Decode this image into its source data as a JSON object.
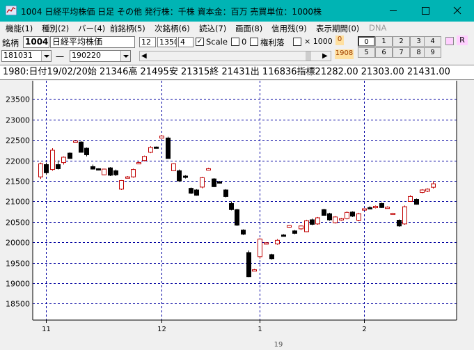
{
  "window": {
    "title": "1004 日経平均株価 日足 その他 発行株：千株 資本金：百万 売買単位：1000株"
  },
  "menu": [
    {
      "label": "機能(1)",
      "enabled": true
    },
    {
      "label": "種別(2)",
      "enabled": true
    },
    {
      "label": "バー(4)",
      "enabled": true
    },
    {
      "label": "前銘柄(5)",
      "enabled": true
    },
    {
      "label": "次銘柄(6)",
      "enabled": true
    },
    {
      "label": "読込(7)",
      "enabled": true
    },
    {
      "label": "画面(8)",
      "enabled": true
    },
    {
      "label": "信用残(9)",
      "enabled": true
    },
    {
      "label": "表示期間(0)",
      "enabled": true
    },
    {
      "label": "DNA",
      "enabled": false
    }
  ],
  "toolbar": {
    "code_label": "銘柄",
    "code_value": "1004",
    "name_value": "日経平均株価",
    "field1": "12",
    "field2": "1350",
    "field3": "4",
    "scale_label": "Scale",
    "scale_checked": true,
    "zero_label": "0",
    "kenri_label": "権利落",
    "x1000_label": "× 1000",
    "top_badge": "0",
    "year_badge": "1908",
    "num_buttons": [
      "0",
      "1",
      "2",
      "3",
      "4",
      "5",
      "6",
      "7",
      "8",
      "9"
    ],
    "r_label": "R",
    "start_date": "181031",
    "dash": "一",
    "end_date": "190220"
  },
  "info_line": "1980:日付19/02/20始 21346高 21495安 21315終 21431出 116836指標21282.00  21303.00  21431.00",
  "colors": {
    "titlebar": "#00b4b4",
    "up_candle": "#c00000",
    "down_candle": "#000000",
    "grid": "#0000a0"
  },
  "chart_data": {
    "type": "candlestick",
    "ylim": [
      18100,
      23950
    ],
    "y_ticks": [
      18500,
      19000,
      19500,
      20000,
      20500,
      21000,
      21500,
      22000,
      22500,
      23000,
      23500
    ],
    "x_tick_labels": [
      {
        "label": "11",
        "index": 1
      },
      {
        "label": "12",
        "index": 21
      },
      {
        "label": "1",
        "index": 38
      },
      {
        "label": "2",
        "index": 56
      }
    ],
    "year_label": "19",
    "candles": [
      {
        "o": 21600,
        "h": 21950,
        "l": 21550,
        "c": 21920
      },
      {
        "o": 21900,
        "h": 21950,
        "l": 21650,
        "c": 21700
      },
      {
        "o": 21780,
        "h": 22300,
        "l": 21750,
        "c": 22250
      },
      {
        "o": 21900,
        "h": 22000,
        "l": 21780,
        "c": 21800
      },
      {
        "o": 21950,
        "h": 22100,
        "l": 21900,
        "c": 22080
      },
      {
        "o": 22180,
        "h": 22200,
        "l": 22050,
        "c": 22050
      },
      {
        "o": 22460,
        "h": 22490,
        "l": 22450,
        "c": 22480
      },
      {
        "o": 22450,
        "h": 22470,
        "l": 22200,
        "c": 22200
      },
      {
        "o": 22300,
        "h": 22320,
        "l": 22100,
        "c": 22140
      },
      {
        "o": 21850,
        "h": 21900,
        "l": 21780,
        "c": 21790
      },
      {
        "o": 21800,
        "h": 21810,
        "l": 21760,
        "c": 21780
      },
      {
        "o": 21650,
        "h": 21800,
        "l": 21640,
        "c": 21790
      },
      {
        "o": 21820,
        "h": 21840,
        "l": 21620,
        "c": 21640
      },
      {
        "o": 21750,
        "h": 21780,
        "l": 21620,
        "c": 21650
      },
      {
        "o": 21300,
        "h": 21520,
        "l": 21280,
        "c": 21510
      },
      {
        "o": 21580,
        "h": 21620,
        "l": 21560,
        "c": 21600
      },
      {
        "o": 21600,
        "h": 21800,
        "l": 21580,
        "c": 21780
      },
      {
        "o": 21930,
        "h": 21970,
        "l": 21920,
        "c": 21950
      },
      {
        "o": 22000,
        "h": 22120,
        "l": 21980,
        "c": 22100
      },
      {
        "o": 22200,
        "h": 22350,
        "l": 22180,
        "c": 22320
      },
      {
        "o": 22330,
        "h": 22340,
        "l": 22300,
        "c": 22300
      },
      {
        "o": 22550,
        "h": 22620,
        "l": 22540,
        "c": 22600
      },
      {
        "o": 22550,
        "h": 22580,
        "l": 22050,
        "c": 22050
      },
      {
        "o": 21750,
        "h": 21930,
        "l": 21740,
        "c": 21920
      },
      {
        "o": 21750,
        "h": 21780,
        "l": 21480,
        "c": 21500
      },
      {
        "o": 21620,
        "h": 21640,
        "l": 21560,
        "c": 21600
      },
      {
        "o": 21320,
        "h": 21340,
        "l": 21180,
        "c": 21200
      },
      {
        "o": 21280,
        "h": 21300,
        "l": 21140,
        "c": 21150
      },
      {
        "o": 21350,
        "h": 21600,
        "l": 21320,
        "c": 21580
      },
      {
        "o": 21780,
        "h": 21820,
        "l": 21760,
        "c": 21800
      },
      {
        "o": 21550,
        "h": 21570,
        "l": 21350,
        "c": 21360
      },
      {
        "o": 21480,
        "h": 21500,
        "l": 21440,
        "c": 21450
      },
      {
        "o": 21280,
        "h": 21300,
        "l": 21100,
        "c": 21120
      },
      {
        "o": 20950,
        "h": 21000,
        "l": 20780,
        "c": 20800
      },
      {
        "o": 20800,
        "h": 20820,
        "l": 20400,
        "c": 20420
      },
      {
        "o": 20300,
        "h": 20320,
        "l": 20180,
        "c": 20200
      },
      {
        "o": 19750,
        "h": 19800,
        "l": 19150,
        "c": 19160
      },
      {
        "o": 19320,
        "h": 19350,
        "l": 19300,
        "c": 19330
      },
      {
        "o": 19650,
        "h": 20100,
        "l": 19600,
        "c": 20080
      },
      {
        "o": 19980,
        "h": 20000,
        "l": 19950,
        "c": 19990
      },
      {
        "o": 19700,
        "h": 19720,
        "l": 19580,
        "c": 19600
      },
      {
        "o": 19960,
        "h": 20080,
        "l": 19940,
        "c": 20050
      },
      {
        "o": 20180,
        "h": 20200,
        "l": 20160,
        "c": 20170
      },
      {
        "o": 20370,
        "h": 20420,
        "l": 20360,
        "c": 20410
      },
      {
        "o": 20280,
        "h": 20300,
        "l": 20200,
        "c": 20220
      },
      {
        "o": 20330,
        "h": 20410,
        "l": 20300,
        "c": 20400
      },
      {
        "o": 20260,
        "h": 20550,
        "l": 20250,
        "c": 20530
      },
      {
        "o": 20550,
        "h": 20580,
        "l": 20420,
        "c": 20440
      },
      {
        "o": 20450,
        "h": 20620,
        "l": 20430,
        "c": 20600
      },
      {
        "o": 20800,
        "h": 20820,
        "l": 20650,
        "c": 20660
      },
      {
        "o": 20700,
        "h": 20720,
        "l": 20530,
        "c": 20550
      },
      {
        "o": 20480,
        "h": 20640,
        "l": 20460,
        "c": 20620
      },
      {
        "o": 20560,
        "h": 20600,
        "l": 20530,
        "c": 20580
      },
      {
        "o": 20580,
        "h": 20760,
        "l": 20560,
        "c": 20730
      },
      {
        "o": 20740,
        "h": 20760,
        "l": 20620,
        "c": 20640
      },
      {
        "o": 20540,
        "h": 20720,
        "l": 20520,
        "c": 20700
      },
      {
        "o": 20800,
        "h": 20830,
        "l": 20780,
        "c": 20820
      },
      {
        "o": 20850,
        "h": 20880,
        "l": 20820,
        "c": 20840
      },
      {
        "o": 20860,
        "h": 20900,
        "l": 20830,
        "c": 20880
      },
      {
        "o": 20950,
        "h": 20970,
        "l": 20840,
        "c": 20850
      },
      {
        "o": 20850,
        "h": 20880,
        "l": 20820,
        "c": 20860
      },
      {
        "o": 20700,
        "h": 20720,
        "l": 20700,
        "c": 20710
      },
      {
        "o": 20540,
        "h": 20560,
        "l": 20380,
        "c": 20400
      },
      {
        "o": 20450,
        "h": 20900,
        "l": 20430,
        "c": 20870
      },
      {
        "o": 21000,
        "h": 21150,
        "l": 20990,
        "c": 21120
      },
      {
        "o": 21050,
        "h": 21070,
        "l": 20920,
        "c": 20930
      },
      {
        "o": 21220,
        "h": 21300,
        "l": 21200,
        "c": 21280
      },
      {
        "o": 21250,
        "h": 21320,
        "l": 21230,
        "c": 21300
      },
      {
        "o": 21346,
        "h": 21495,
        "l": 21315,
        "c": 21431
      }
    ]
  }
}
